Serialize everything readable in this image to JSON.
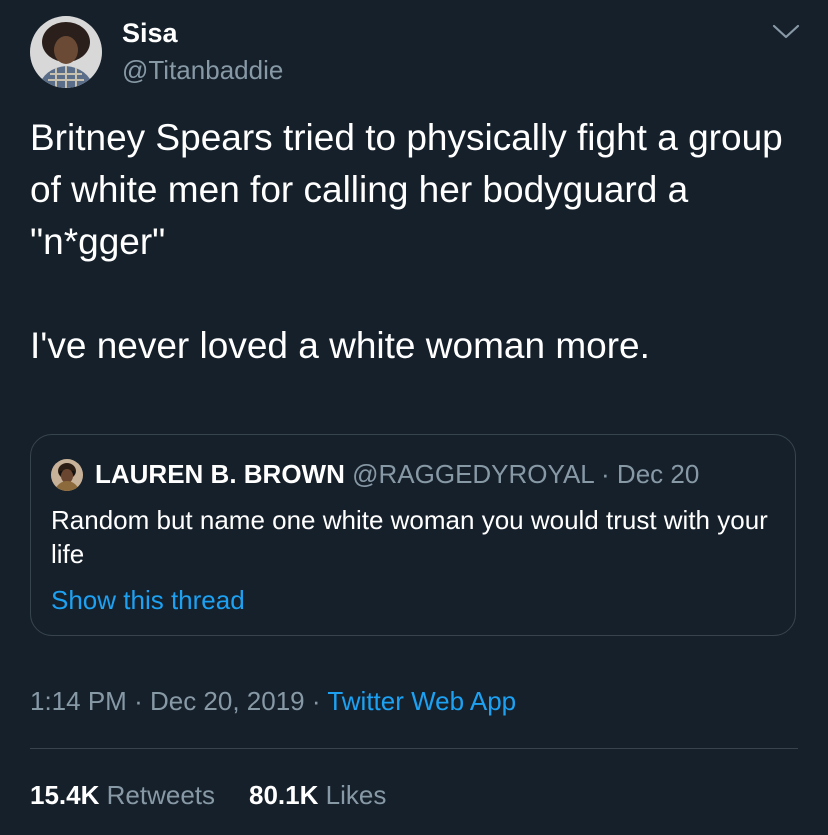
{
  "tweet": {
    "author": {
      "display_name": "Sisa",
      "handle": "@Titanbaddie",
      "avatar_icon": "profile-photo"
    },
    "menu_icon": "chevron-down-icon",
    "body": {
      "paragraph_1": "Britney Spears tried to physically fight a group of white men for calling her bodyguard a \"n*gger\"",
      "paragraph_2": "I've never loved a white woman more."
    },
    "quoted_tweet": {
      "avatar_icon": "profile-photo",
      "display_name": "LAUREN B. BROWN",
      "handle": "@RAGGEDYROYAL",
      "separator": "·",
      "date": "Dec 20",
      "text": "Random but name one white woman you would trust with your life",
      "show_thread_label": "Show this thread"
    },
    "meta": {
      "time": "1:14 PM",
      "separator": "·",
      "date": "Dec 20, 2019",
      "separator_2": "·",
      "source": "Twitter Web App"
    },
    "stats": {
      "retweets_count": "15.4K",
      "retweets_label": "Retweets",
      "likes_count": "80.1K",
      "likes_label": "Likes"
    }
  },
  "colors": {
    "background": "#15202b",
    "primary_text": "#ffffff",
    "secondary_text": "#8899a6",
    "accent": "#1da1f2",
    "border": "#38444d"
  }
}
